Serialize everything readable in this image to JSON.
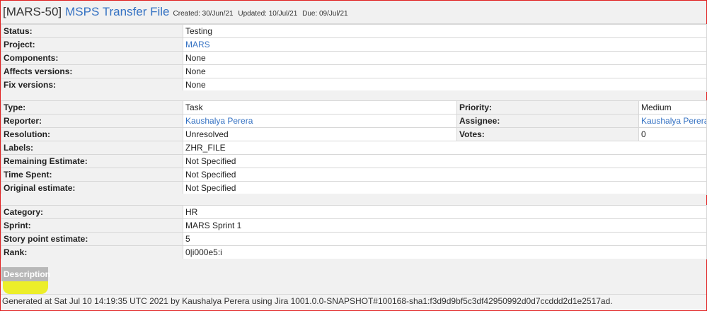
{
  "issue": {
    "key": "[MARS-50]",
    "summary": "MSPS Transfer File",
    "created": "Created: 30/Jun/21",
    "updated": "Updated: 10/Jul/21",
    "due": "Due: 09/Jul/21"
  },
  "group1": [
    {
      "label": "Status:",
      "value": "Testing"
    },
    {
      "label": "Project:",
      "value": "MARS"
    },
    {
      "label": "Components:",
      "value": "None"
    },
    {
      "label": "Affects versions:",
      "value": "None"
    },
    {
      "label": "Fix versions:",
      "value": "None"
    }
  ],
  "group2": {
    "type_label": "Type:",
    "type_value": "Task",
    "priority_label": "Priority:",
    "priority_value": "Medium",
    "reporter_label": "Reporter:",
    "reporter_value": "Kaushalya Perera",
    "assignee_label": "Assignee:",
    "assignee_value": "Kaushalya Perera",
    "resolution_label": "Resolution:",
    "resolution_value": "Unresolved",
    "votes_label": "Votes:",
    "votes_value": "0",
    "labels_label": "Labels:",
    "labels_value": "ZHR_FILE",
    "remaining_label": "Remaining Estimate:",
    "remaining_value": "Not Specified",
    "timespent_label": "Time Spent:",
    "timespent_value": "Not Specified",
    "original_label": "Original estimate:",
    "original_value": "Not Specified"
  },
  "group3": [
    {
      "label": "Category:",
      "value": "HR"
    },
    {
      "label": "Sprint:",
      "value": "MARS Sprint 1"
    },
    {
      "label": "Story point estimate:",
      "value": "5"
    },
    {
      "label": "Rank:",
      "value": "0|i000e5:i"
    }
  ],
  "description_tab": "Description",
  "footer": "Generated at Sat Jul 10 14:19:35 UTC 2021 by Kaushalya Perera using Jira 1001.0.0-SNAPSHOT#100168-sha1:f3d9d9bf5c3df42950992d0d7ccddd2d1e2517ad.",
  "colors": {
    "link": "#3572c3",
    "label_bg": "#f1f1f1",
    "border_frame": "#e02020",
    "highlight": "#ecee2a",
    "tab_bg": "#b8b8b8"
  }
}
